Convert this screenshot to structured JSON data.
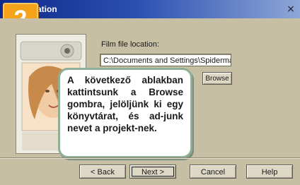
{
  "window": {
    "title": "ation",
    "close_glyph": "×"
  },
  "step_badge": {
    "number": "2",
    "color": "#f4a218"
  },
  "form": {
    "label": "Film file location:",
    "location_value": "C:\\Documents and Settings\\Spiderman",
    "browse_label": "Browse"
  },
  "callout": {
    "text": "A következő ablakban kattintsunk a Browse gombra, jelöljünk ki egy könyvtárat, és ad-junk nevet a projekt-nek."
  },
  "buttons": {
    "back": "< Back",
    "next": "Next >",
    "cancel": "Cancel",
    "help": "Help"
  },
  "icons": {
    "close": "close-icon",
    "wizard_image": "wizard-photo-image"
  }
}
